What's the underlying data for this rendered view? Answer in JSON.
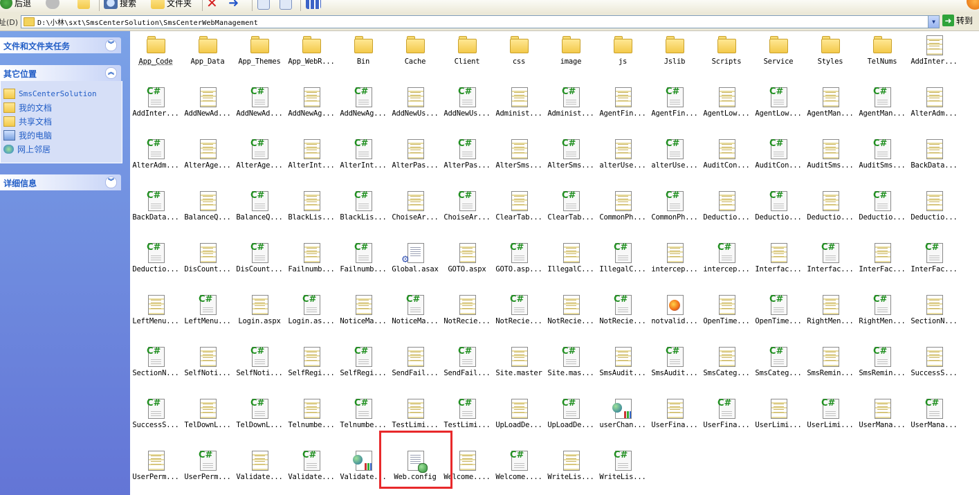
{
  "toolbar": {
    "back_label": "后退",
    "search_label": "搜索",
    "folders_label": "文件夹"
  },
  "address": {
    "label": "址(D)",
    "path": "D:\\小林\\sxt\\SmsCenterSolution\\SmsCenterWebManagement",
    "go_label": "转到"
  },
  "leftpane": {
    "tasks_title": "文件和文件夹任务",
    "places_title": "其它位置",
    "places": [
      "SmsCenterSolution",
      "我的文档",
      "共享文档",
      "我的电脑",
      "网上邻居"
    ],
    "details_title": "详细信息"
  },
  "files": [
    {
      "name": "App_Code",
      "type": "folder"
    },
    {
      "name": "App_Data",
      "type": "folder"
    },
    {
      "name": "App_Themes",
      "type": "folder"
    },
    {
      "name": "App_WebR...",
      "type": "folder"
    },
    {
      "name": "Bin",
      "type": "folder"
    },
    {
      "name": "Cache",
      "type": "folder"
    },
    {
      "name": "Client",
      "type": "folder"
    },
    {
      "name": "css",
      "type": "folder"
    },
    {
      "name": "image",
      "type": "folder"
    },
    {
      "name": "js",
      "type": "folder"
    },
    {
      "name": "Jslib",
      "type": "folder"
    },
    {
      "name": "Scripts",
      "type": "folder"
    },
    {
      "name": "Service",
      "type": "folder"
    },
    {
      "name": "Styles",
      "type": "folder"
    },
    {
      "name": "TelNums",
      "type": "folder"
    },
    {
      "name": "AddInter...",
      "type": "aspx"
    },
    {
      "name": "AddInter...",
      "type": "cs"
    },
    {
      "name": "AddNewAd...",
      "type": "aspx"
    },
    {
      "name": "AddNewAd...",
      "type": "cs"
    },
    {
      "name": "AddNewAg...",
      "type": "aspx"
    },
    {
      "name": "AddNewAg...",
      "type": "cs"
    },
    {
      "name": "AddNewUs...",
      "type": "aspx"
    },
    {
      "name": "AddNewUs...",
      "type": "cs"
    },
    {
      "name": "Administ...",
      "type": "aspx"
    },
    {
      "name": "Administ...",
      "type": "cs"
    },
    {
      "name": "AgentFin...",
      "type": "aspx"
    },
    {
      "name": "AgentFin...",
      "type": "cs"
    },
    {
      "name": "AgentLow...",
      "type": "aspx"
    },
    {
      "name": "AgentLow...",
      "type": "cs"
    },
    {
      "name": "AgentMan...",
      "type": "aspx"
    },
    {
      "name": "AgentMan...",
      "type": "cs"
    },
    {
      "name": "AlterAdm...",
      "type": "aspx"
    },
    {
      "name": "AlterAdm...",
      "type": "cs"
    },
    {
      "name": "AlterAge...",
      "type": "aspx"
    },
    {
      "name": "AlterAge...",
      "type": "cs"
    },
    {
      "name": "AlterInt...",
      "type": "aspx"
    },
    {
      "name": "AlterInt...",
      "type": "cs"
    },
    {
      "name": "AlterPas...",
      "type": "aspx"
    },
    {
      "name": "AlterPas...",
      "type": "cs"
    },
    {
      "name": "AlterSms...",
      "type": "aspx"
    },
    {
      "name": "AlterSms...",
      "type": "cs"
    },
    {
      "name": "alterUse...",
      "type": "aspx"
    },
    {
      "name": "alterUse...",
      "type": "cs"
    },
    {
      "name": "AuditCon...",
      "type": "aspx"
    },
    {
      "name": "AuditCon...",
      "type": "cs"
    },
    {
      "name": "AuditSms...",
      "type": "aspx"
    },
    {
      "name": "AuditSms...",
      "type": "cs"
    },
    {
      "name": "BackData...",
      "type": "aspx"
    },
    {
      "name": "BackData...",
      "type": "cs"
    },
    {
      "name": "BalanceQ...",
      "type": "aspx"
    },
    {
      "name": "BalanceQ...",
      "type": "cs"
    },
    {
      "name": "BlackLis...",
      "type": "aspx"
    },
    {
      "name": "BlackLis...",
      "type": "cs"
    },
    {
      "name": "ChoiseAr...",
      "type": "aspx"
    },
    {
      "name": "ChoiseAr...",
      "type": "cs"
    },
    {
      "name": "ClearTab...",
      "type": "aspx"
    },
    {
      "name": "ClearTab...",
      "type": "cs"
    },
    {
      "name": "CommonPh...",
      "type": "aspx"
    },
    {
      "name": "CommonPh...",
      "type": "cs"
    },
    {
      "name": "Deductio...",
      "type": "aspx"
    },
    {
      "name": "Deductio...",
      "type": "cs"
    },
    {
      "name": "Deductio...",
      "type": "aspx"
    },
    {
      "name": "Deductio...",
      "type": "cs"
    },
    {
      "name": "Deductio...",
      "type": "aspx"
    },
    {
      "name": "Deductio...",
      "type": "cs"
    },
    {
      "name": "DisCount...",
      "type": "aspx"
    },
    {
      "name": "DisCount...",
      "type": "cs"
    },
    {
      "name": "Failnumb...",
      "type": "aspx"
    },
    {
      "name": "Failnumb...",
      "type": "cs"
    },
    {
      "name": "Global.asax",
      "type": "asax"
    },
    {
      "name": "GOTO.aspx",
      "type": "aspx"
    },
    {
      "name": "GOTO.asp...",
      "type": "cs"
    },
    {
      "name": "IllegalC...",
      "type": "aspx"
    },
    {
      "name": "IllegalC...",
      "type": "cs"
    },
    {
      "name": "intercep...",
      "type": "aspx"
    },
    {
      "name": "intercep...",
      "type": "cs"
    },
    {
      "name": "Interfac...",
      "type": "aspx"
    },
    {
      "name": "Interfac...",
      "type": "cs"
    },
    {
      "name": "InterFac...",
      "type": "aspx"
    },
    {
      "name": "InterFac...",
      "type": "cs"
    },
    {
      "name": "LeftMenu...",
      "type": "aspx"
    },
    {
      "name": "LeftMenu...",
      "type": "cs"
    },
    {
      "name": "Login.aspx",
      "type": "aspx"
    },
    {
      "name": "Login.as...",
      "type": "cs"
    },
    {
      "name": "NoticeMa...",
      "type": "aspx"
    },
    {
      "name": "NoticeMa...",
      "type": "cs"
    },
    {
      "name": "NotRecie...",
      "type": "aspx"
    },
    {
      "name": "NotRecie...",
      "type": "cs"
    },
    {
      "name": "NotRecie...",
      "type": "aspx"
    },
    {
      "name": "NotRecie...",
      "type": "cs"
    },
    {
      "name": "notvalid...",
      "type": "html"
    },
    {
      "name": "OpenTime...",
      "type": "aspx"
    },
    {
      "name": "OpenTime...",
      "type": "cs"
    },
    {
      "name": "RightMen...",
      "type": "aspx"
    },
    {
      "name": "RightMen...",
      "type": "cs"
    },
    {
      "name": "SectionN...",
      "type": "aspx"
    },
    {
      "name": "SectionN...",
      "type": "cs"
    },
    {
      "name": "SelfNoti...",
      "type": "aspx"
    },
    {
      "name": "SelfNoti...",
      "type": "cs"
    },
    {
      "name": "SelfRegi...",
      "type": "aspx"
    },
    {
      "name": "SelfRegi...",
      "type": "cs"
    },
    {
      "name": "SendFail...",
      "type": "aspx"
    },
    {
      "name": "SendFail...",
      "type": "cs"
    },
    {
      "name": "Site.master",
      "type": "aspx"
    },
    {
      "name": "Site.mas...",
      "type": "cs"
    },
    {
      "name": "SmsAudit...",
      "type": "aspx"
    },
    {
      "name": "SmsAudit...",
      "type": "cs"
    },
    {
      "name": "SmsCateg...",
      "type": "aspx"
    },
    {
      "name": "SmsCateg...",
      "type": "cs"
    },
    {
      "name": "SmsRemin...",
      "type": "aspx"
    },
    {
      "name": "SmsRemin...",
      "type": "cs"
    },
    {
      "name": "SuccessS...",
      "type": "aspx"
    },
    {
      "name": "SuccessS...",
      "type": "cs"
    },
    {
      "name": "TelDownL...",
      "type": "aspx"
    },
    {
      "name": "TelDownL...",
      "type": "cs"
    },
    {
      "name": "Telnumbe...",
      "type": "aspx"
    },
    {
      "name": "Telnumbe...",
      "type": "cs"
    },
    {
      "name": "TestLimi...",
      "type": "aspx"
    },
    {
      "name": "TestLimi...",
      "type": "cs"
    },
    {
      "name": "UpLoadDe...",
      "type": "aspx"
    },
    {
      "name": "UpLoadDe...",
      "type": "cs"
    },
    {
      "name": "userChan...",
      "type": "ashx"
    },
    {
      "name": "UserFina...",
      "type": "aspx"
    },
    {
      "name": "UserFina...",
      "type": "cs"
    },
    {
      "name": "UserLimi...",
      "type": "aspx"
    },
    {
      "name": "UserLimi...",
      "type": "cs"
    },
    {
      "name": "UserMana...",
      "type": "aspx"
    },
    {
      "name": "UserMana...",
      "type": "cs"
    },
    {
      "name": "UserPerm...",
      "type": "aspx"
    },
    {
      "name": "UserPerm...",
      "type": "cs"
    },
    {
      "name": "Validate...",
      "type": "aspx"
    },
    {
      "name": "Validate...",
      "type": "cs"
    },
    {
      "name": "Validate...",
      "type": "ashx"
    },
    {
      "name": "Web.config",
      "type": "cfg"
    },
    {
      "name": "Welcome....",
      "type": "aspx"
    },
    {
      "name": "Welcome....",
      "type": "cs"
    },
    {
      "name": "WriteLis...",
      "type": "aspx"
    },
    {
      "name": "WriteLis...",
      "type": "cs"
    }
  ],
  "highlight_color": "#e8292b"
}
